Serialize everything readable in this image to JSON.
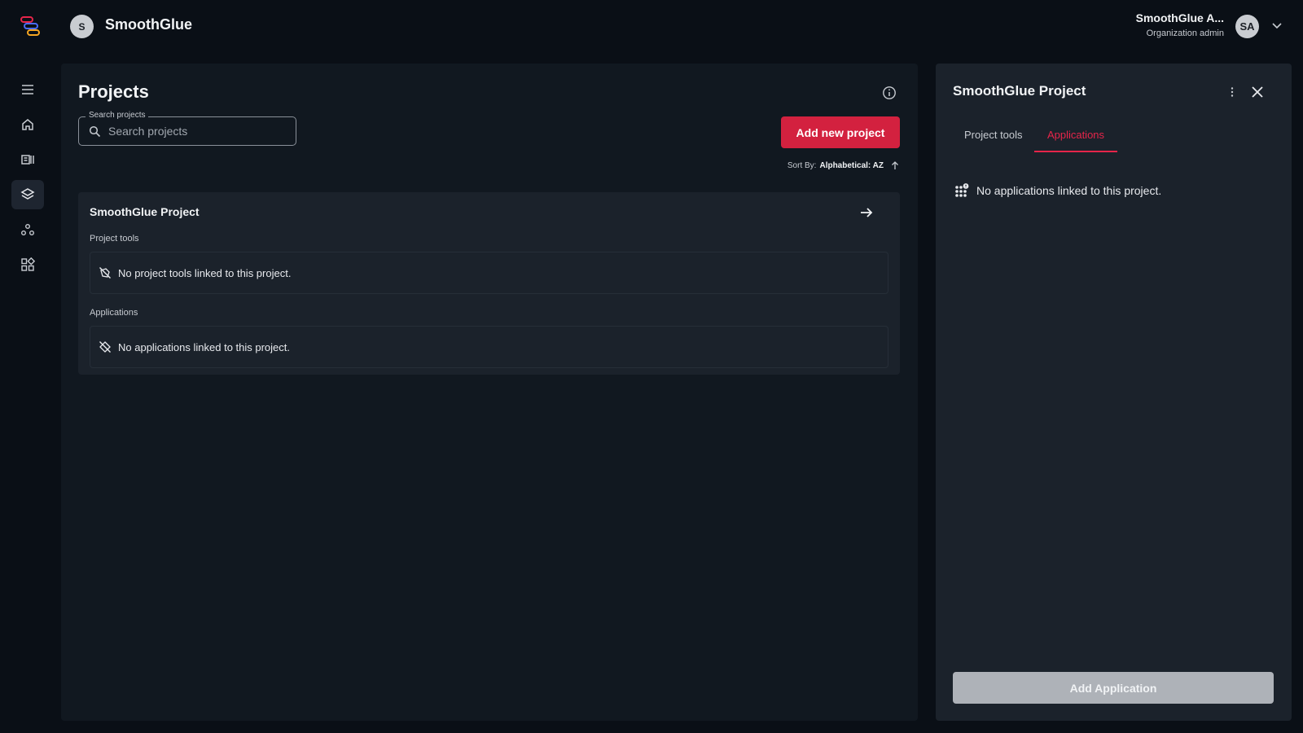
{
  "header": {
    "org_initial": "S",
    "org_name": "SmoothGlue",
    "user_name": "SmoothGlue A...",
    "user_role": "Organization admin",
    "user_initials": "SA"
  },
  "sidebar": {
    "items": [
      {
        "icon": "menu-icon"
      },
      {
        "icon": "home-icon"
      },
      {
        "icon": "catalog-icon"
      },
      {
        "icon": "layers-icon",
        "active": true
      },
      {
        "icon": "groups-icon"
      },
      {
        "icon": "apps-grid-icon"
      }
    ]
  },
  "main": {
    "title": "Projects",
    "search": {
      "legend": "Search projects",
      "placeholder": "Search projects",
      "value": ""
    },
    "add_button": "Add new project",
    "sort": {
      "label": "Sort By:",
      "value": "Alphabetical: AZ"
    },
    "card": {
      "title": "SmoothGlue Project",
      "tools_label": "Project tools",
      "tools_empty": "No project tools linked to this project.",
      "apps_label": "Applications",
      "apps_empty": "No applications linked to this project."
    }
  },
  "detail": {
    "title": "SmoothGlue Project",
    "tabs": [
      {
        "label": "Project tools",
        "active": false
      },
      {
        "label": "Applications",
        "active": true
      }
    ],
    "empty_text": "No applications linked to this project.",
    "add_button": "Add Application"
  },
  "colors": {
    "accent": "#d3213f",
    "tab_active": "#e6254a",
    "background": "#0a0f16",
    "panel": "#111820",
    "card": "#1b222b"
  }
}
